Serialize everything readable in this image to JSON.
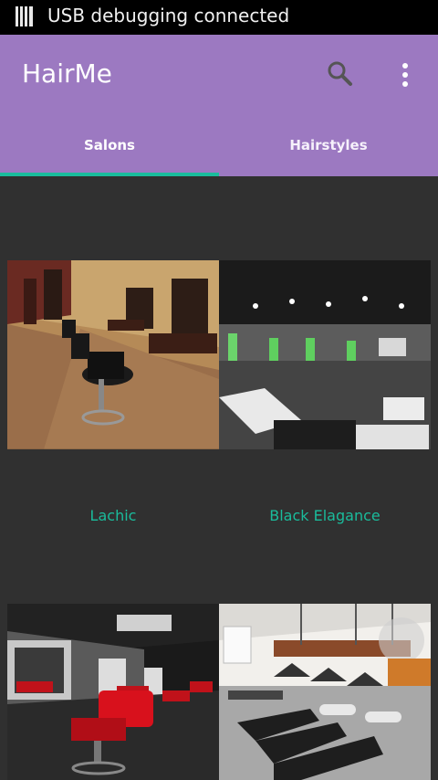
{
  "status_bar": {
    "notification_icon": "usb-debug-icon",
    "text": "USB debugging connected"
  },
  "app_bar": {
    "title": "HairMe",
    "actions": [
      "search-icon",
      "more-vert-icon"
    ],
    "color": "#9c79c1"
  },
  "tabs": [
    {
      "label": "Salons",
      "selected": true
    },
    {
      "label": "Hairstyles",
      "selected": false
    }
  ],
  "accent_color": "#1abc9c",
  "salons": [
    {
      "name": "Lachic"
    },
    {
      "name": "Black Elagance"
    },
    {
      "name": ""
    },
    {
      "name": ""
    }
  ]
}
